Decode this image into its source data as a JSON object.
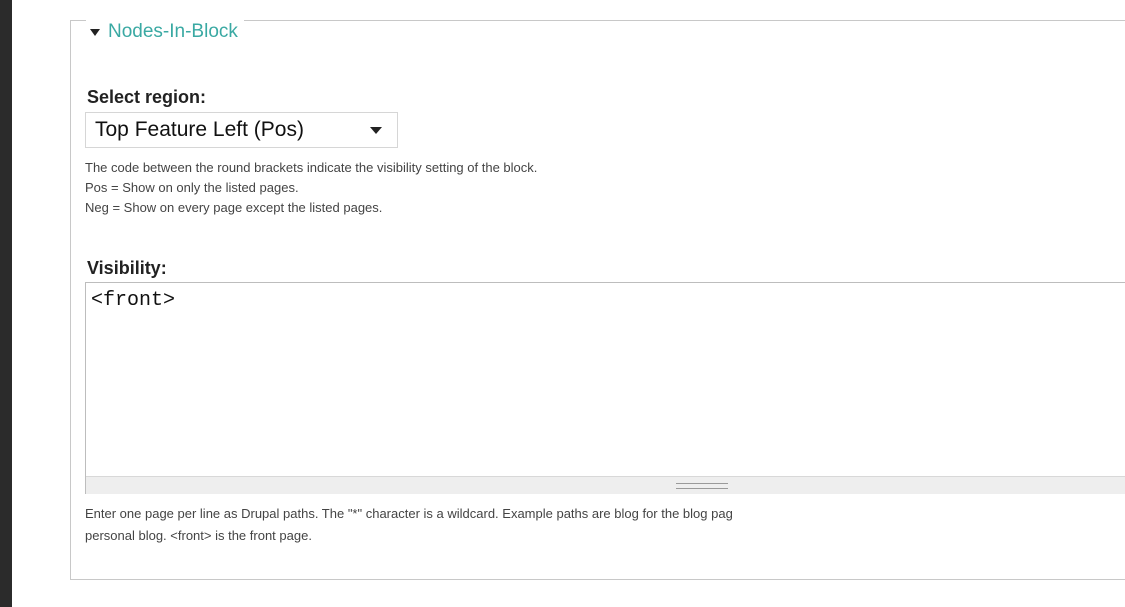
{
  "fieldset": {
    "legend": "Nodes-In-Block"
  },
  "region": {
    "label": "Select region:",
    "selected": "Top Feature Left (Pos)",
    "help_lines": [
      "The code between the round brackets indicate the visibility setting of the block.",
      "Pos = Show on only the listed pages.",
      "Neg = Show on every page except the listed pages."
    ]
  },
  "visibility": {
    "label": "Visibility:",
    "value": "<front>",
    "help_lines": [
      "Enter one page per line as Drupal paths. The \"*\" character is a wildcard. Example paths are blog for the blog pag",
      "personal blog. <front> is the front page."
    ]
  }
}
